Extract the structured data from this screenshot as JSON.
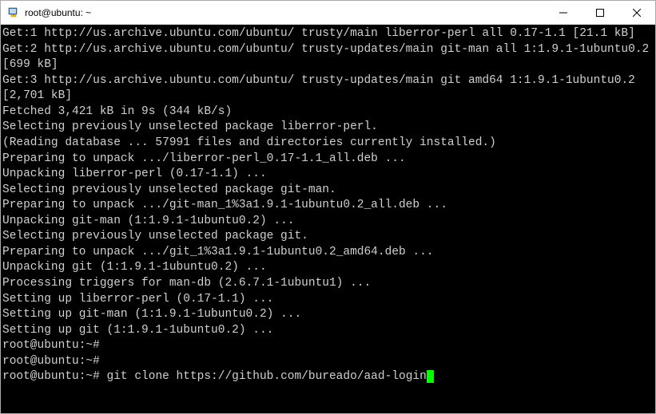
{
  "window": {
    "title": "root@ubuntu: ~"
  },
  "terminal": {
    "lines": [
      "Get:1 http://us.archive.ubuntu.com/ubuntu/ trusty/main liberror-perl all 0.17-1.1 [21.1 kB]",
      "Get:2 http://us.archive.ubuntu.com/ubuntu/ trusty-updates/main git-man all 1:1.9.1-1ubuntu0.2 [699 kB]",
      "Get:3 http://us.archive.ubuntu.com/ubuntu/ trusty-updates/main git amd64 1:1.9.1-1ubuntu0.2 [2,701 kB]",
      "Fetched 3,421 kB in 9s (344 kB/s)",
      "Selecting previously unselected package liberror-perl.",
      "(Reading database ... 57991 files and directories currently installed.)",
      "Preparing to unpack .../liberror-perl_0.17-1.1_all.deb ...",
      "Unpacking liberror-perl (0.17-1.1) ...",
      "Selecting previously unselected package git-man.",
      "Preparing to unpack .../git-man_1%3a1.9.1-1ubuntu0.2_all.deb ...",
      "Unpacking git-man (1:1.9.1-1ubuntu0.2) ...",
      "Selecting previously unselected package git.",
      "Preparing to unpack .../git_1%3a1.9.1-1ubuntu0.2_amd64.deb ...",
      "Unpacking git (1:1.9.1-1ubuntu0.2) ...",
      "Processing triggers for man-db (2.6.7.1-1ubuntu1) ...",
      "Setting up liberror-perl (0.17-1.1) ...",
      "Setting up git-man (1:1.9.1-1ubuntu0.2) ...",
      "Setting up git (1:1.9.1-1ubuntu0.2) ...",
      "root@ubuntu:~#",
      "root@ubuntu:~#"
    ],
    "prompt": "root@ubuntu:~# ",
    "command": "git clone https://github.com/bureado/aad-login"
  }
}
